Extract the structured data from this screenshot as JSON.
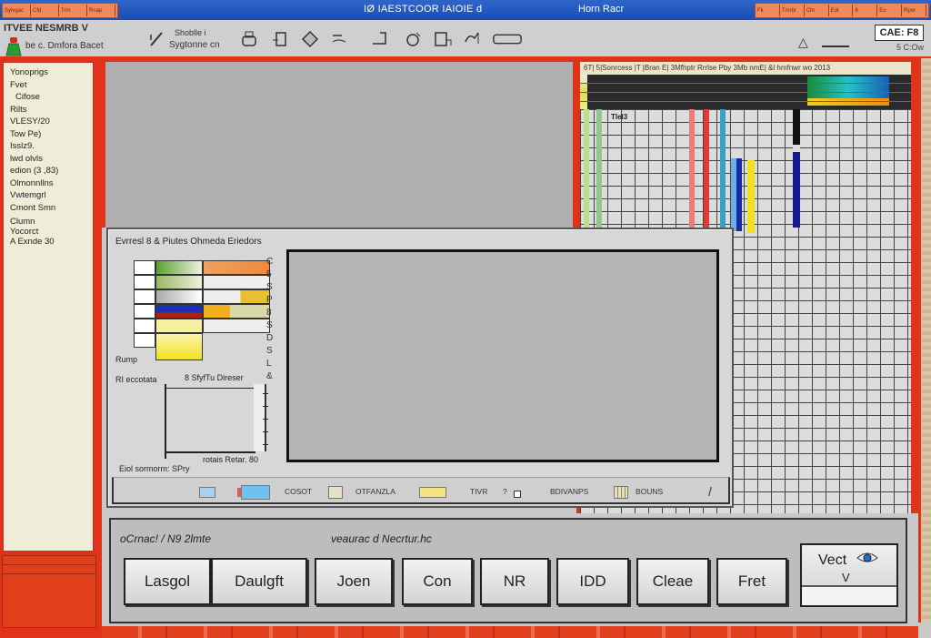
{
  "window": {
    "title": "IØ IAESTCOOR IAIOIE d",
    "title_secondary": "Horn Racr",
    "left_tabs": [
      "Sylvgac",
      "Cfd",
      "Trm",
      "Rnap"
    ],
    "right_tabs": [
      "Fk",
      "Tmrbr",
      "Chr",
      "Edr",
      "8",
      "Eo",
      "Rpor"
    ]
  },
  "toolbar": {
    "app_label": "ITVEE NESMRB V",
    "app_sublabel": "be c. Dmfora Bacet",
    "text_top": "Shoblle i",
    "text_bottom": "Sygtonne cn",
    "icons": [
      "pen-icon",
      "print-icon",
      "document-icon",
      "paint-bucket-icon",
      "eraser-icon",
      "frame-icon",
      "shapes-icon",
      "chart-icon",
      "tools-icon",
      "ruler-icon"
    ],
    "right_box": "CAE: F8",
    "right_sub": "5 C:Ow",
    "warning_icon": "warning-icon"
  },
  "left_panel": {
    "items": [
      "Yonoprigs",
      "Fvet",
      "Cifose",
      "Rilts",
      "VLESY/20",
      "Tow Pe)",
      "Isslz9.",
      "lwd olvls",
      "edion (3 ,83)",
      "Olmonnllns",
      "Vwtemgrl",
      "Cmont Smn",
      "Clumn",
      "Yocorct",
      "A Exnde 30"
    ]
  },
  "sheet": {
    "header_text": "6T| 5|Sonrcess  |T  |Bran E| 3Mfhptr Rrrlse  Pby 3Mb  nmE| &l hmfnwr  wo  2013",
    "cell_label": "Tlel3"
  },
  "dialog": {
    "title": "Evrresl 8 & Piutes Ohmeda Eriedors",
    "legend_right_labels": [
      "C",
      "5",
      "S",
      "P",
      "8",
      "S",
      "D",
      "S",
      "L",
      "&"
    ],
    "label_ramp": "Rump",
    "label_rr": "RI eccotata",
    "mini_chart_title": "8 SfyfTu Direser",
    "mini_chart_value": "rotais Retar. 80",
    "label_bottom": "Eiol sormorm: SPry",
    "footer": {
      "item1": "COSOT",
      "item2": "OTFANZLA",
      "item3": "TIVR",
      "item4": "BDIVANPS",
      "item5": "BOUNS"
    }
  },
  "action_panel": {
    "label_left": "oCrnac! / N9 2lmte",
    "label_right": "veaurac d Necrtur.hc",
    "buttons": [
      "Lasgol",
      "Daulgft",
      "Joen",
      "Con",
      "NR",
      "IDD",
      "Cleae",
      "Fret"
    ],
    "vect_button": {
      "label": "Vect",
      "sub": "V"
    }
  },
  "colors": {
    "accent_red": "#e0331a",
    "title_blue": "#2f66c8",
    "panel_cream": "#efedd8"
  }
}
